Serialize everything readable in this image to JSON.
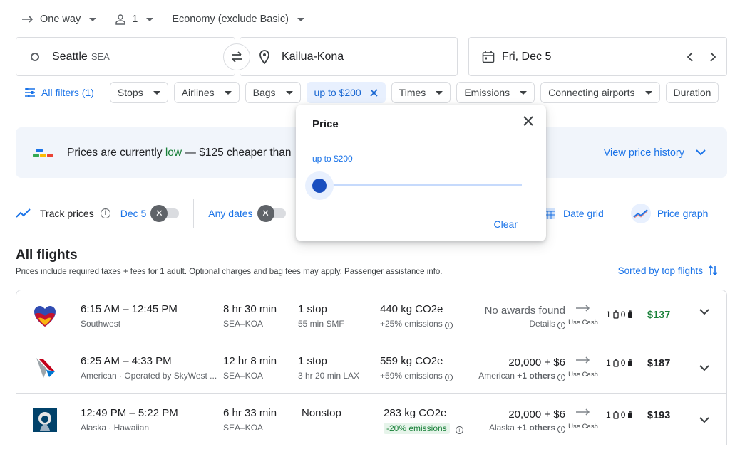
{
  "search_options": {
    "trip_type": "One way",
    "passengers": "1",
    "cabin_class": "Economy (exclude Basic)"
  },
  "search": {
    "origin_city": "Seattle",
    "origin_code": "SEA",
    "destination": "Kailua-Kona",
    "date": "Fri, Dec 5"
  },
  "filters": {
    "all_filters": "All filters (1)",
    "chips": [
      "Stops",
      "Airlines",
      "Bags",
      "up to $200",
      "Times",
      "Emissions",
      "Connecting airports",
      "Duration"
    ]
  },
  "insights": {
    "prefix": "Prices are currently ",
    "level": "low",
    "suffix": " — $125 cheaper than",
    "view_history": "View price history",
    "colors": {
      "blue": "#1a73e8",
      "green": "#34a853",
      "yellow": "#fbbc04",
      "red": "#ea4335"
    }
  },
  "track": {
    "label": "Track prices",
    "date_option": "Dec 5",
    "any_dates": "Any dates",
    "date_grid": "Date grid",
    "price_graph": "Price graph"
  },
  "results": {
    "heading": "All flights",
    "note_prefix": "Prices include required taxes + fees for 1 adult. Optional charges and ",
    "bag_fees": "bag fees",
    "note_mid": " may apply. ",
    "assistance": "Passenger assistance",
    "note_suffix": " info.",
    "sorted_by": "Sorted by top flights"
  },
  "flights": [
    {
      "airline_icon": "southwest-logo",
      "times": "6:15 AM – 12:45 PM",
      "airline": "Southwest",
      "duration": "8 hr 30 min",
      "route": "SEA–KOA",
      "stops": "1 stop",
      "layover": "55 min SMF",
      "co2": "440 kg CO2e",
      "emissions": "+25% emissions",
      "award": "No awards found",
      "award_sub": "Details",
      "use_cash": "Use Cash",
      "carry_on": "1",
      "checked": "0",
      "price": "$137"
    },
    {
      "airline_icon": "american-logo",
      "times": "6:25 AM – 4:33 PM",
      "airline": "American · Operated by SkyWest ...",
      "duration": "12 hr 8 min",
      "route": "SEA–KOA",
      "stops": "1 stop",
      "layover": "3 hr 20 min LAX",
      "co2": "559 kg CO2e",
      "emissions": "+59% emissions",
      "award": "20,000 + $6",
      "award_sub_prefix": "American ",
      "award_sub_bold": "+1 others",
      "use_cash": "Use Cash",
      "carry_on": "1",
      "checked": "0",
      "price": "$187"
    },
    {
      "airline_icon": "alaska-logo",
      "times": "12:49 PM – 5:22 PM",
      "airline": "Alaska · Hawaiian",
      "duration": "6 hr 33 min",
      "route": "SEA–KOA",
      "stops": "Nonstop",
      "co2": "283 kg CO2e",
      "emissions": "-20% emissions",
      "award": "20,000 + $6",
      "award_sub_prefix": "Alaska ",
      "award_sub_bold": "+1 others",
      "use_cash": "Use Cash",
      "carry_on": "1",
      "checked": "0",
      "price": "$193"
    }
  ],
  "price_popup": {
    "title": "Price",
    "limit_label": "up to $200",
    "clear": "Clear"
  }
}
